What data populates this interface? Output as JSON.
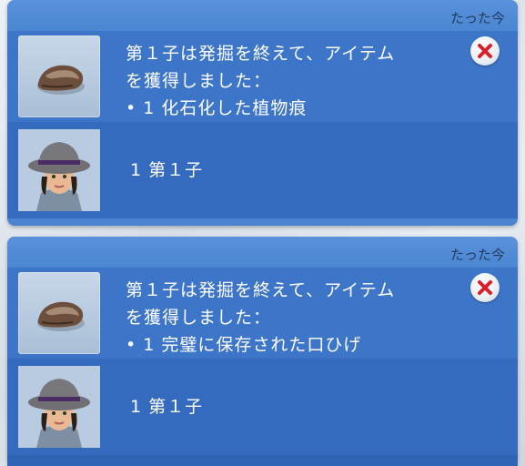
{
  "notifications": [
    {
      "timestamp": "たった今",
      "message_line1": "第１子は発掘を終えて、アイテム",
      "message_line2": "を獲得しました：",
      "item_line": "• 1 化石化した植物痕",
      "item_icon": "rock-fossil-icon",
      "sim_icon": "sim-portrait-icon",
      "sim_label": "1 第１子",
      "close_icon": "close-icon"
    },
    {
      "timestamp": "たった今",
      "message_line1": "第１子は発掘を終えて、アイテム",
      "message_line2": "を獲得しました：",
      "item_line": "• 1 完璧に保存された口ひげ",
      "item_icon": "rock-fossil-icon",
      "sim_icon": "sim-portrait-icon",
      "sim_label": "1 第１子",
      "close_icon": "close-icon"
    }
  ],
  "colors": {
    "card": "#4a83cf",
    "close_red": "#d8202a",
    "text": "#ffffff"
  }
}
